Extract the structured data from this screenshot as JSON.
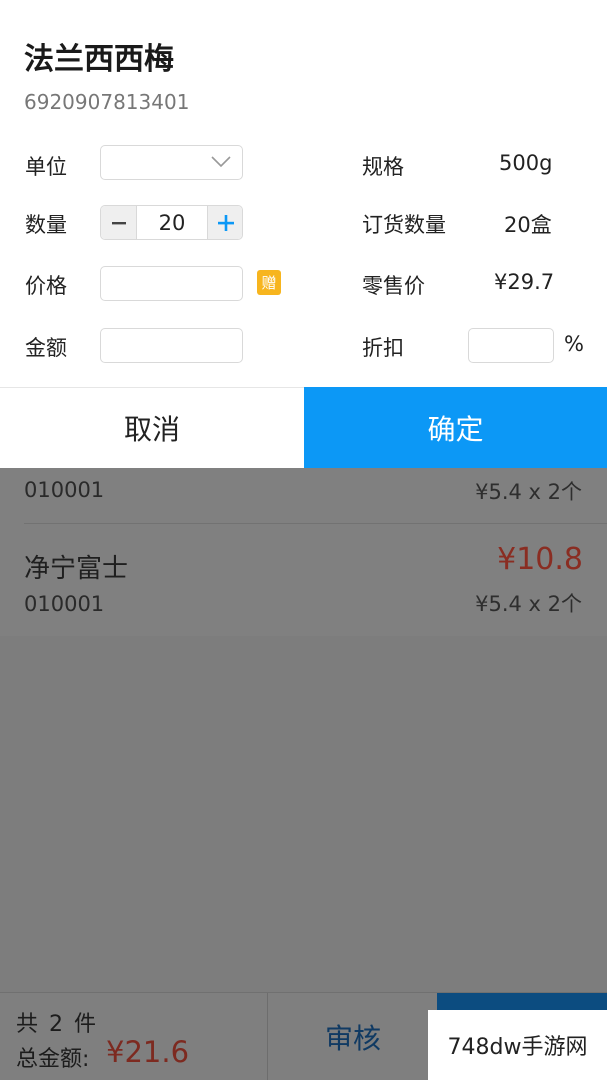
{
  "list": {
    "item1": {
      "code": "010001",
      "unit_price": "¥5.4 x 2个"
    },
    "item2": {
      "name": "净宁富士",
      "code": "010001",
      "total": "¥10.8",
      "unit_price": "¥5.4 x 2个"
    }
  },
  "footer": {
    "count": "共 2 件",
    "total_label": "总金额:",
    "total_value": "¥21.6",
    "audit_label": "审核"
  },
  "watermark": "748dw手游网",
  "dialog": {
    "product_name": "法兰西西梅",
    "barcode": "6920907813401",
    "unit_label": "单位",
    "unit_value": "",
    "quantity_label": "数量",
    "quantity_value": "20",
    "price_label": "价格",
    "price_value": "",
    "gift_badge": "赠",
    "amount_label": "金额",
    "amount_value": "",
    "spec_label": "规格",
    "spec_value": "500g",
    "order_qty_label": "订货数量",
    "order_qty_value": "20盒",
    "retail_label": "零售价",
    "retail_value": "¥29.7",
    "discount_label": "折扣",
    "discount_value": "",
    "percent": "%",
    "cancel_label": "取消",
    "confirm_label": "确定"
  },
  "colors": {
    "confirm_bg": "#0c98f6",
    "gift_badge": "#f7b51e",
    "price_red": "#d23a28",
    "overlay_gray": "#7f7f7f"
  }
}
